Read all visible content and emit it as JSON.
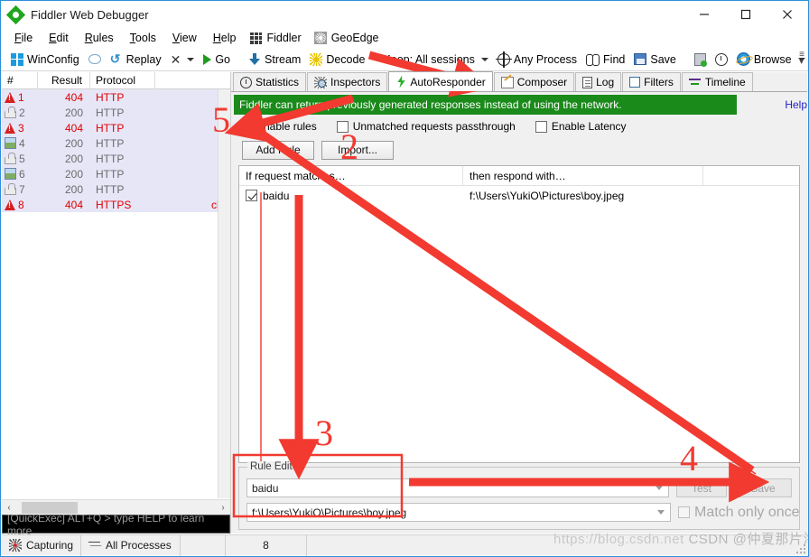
{
  "window": {
    "title": "Fiddler Web Debugger",
    "logo_icon": "fiddler-diamond-icon",
    "minimize_label": "—",
    "maximize_label": "□",
    "close_label": "✕"
  },
  "menubar": {
    "items": [
      {
        "label": "File",
        "mnemonic": "F"
      },
      {
        "label": "Edit",
        "mnemonic": "E"
      },
      {
        "label": "Rules",
        "mnemonic": "R"
      },
      {
        "label": "Tools",
        "mnemonic": "T"
      },
      {
        "label": "View",
        "mnemonic": "V"
      },
      {
        "label": "Help",
        "mnemonic": "H"
      }
    ],
    "plugins": [
      {
        "label": "Fiddler",
        "icon": "fiddler-grid-icon"
      },
      {
        "label": "GeoEdge",
        "icon": "geoedge-globe-icon"
      }
    ]
  },
  "toolbar": {
    "winconfig": "WinConfig",
    "comment_icon": "comment-bubble-icon",
    "replay": "Replay",
    "remove": "✕",
    "go": "Go",
    "stream": "Stream",
    "decode": "Decode",
    "keep": "Keep: All sessions",
    "process": "Any Process",
    "find": "Find",
    "save": "Save",
    "screenshot_icon": "camera-clipboard-icon",
    "timer_icon": "clock-icon",
    "browse": "Browse",
    "overflow_icon": "toolbar-overflow-icon"
  },
  "sessions": {
    "columns": [
      "#",
      "Result",
      "Protocol",
      ""
    ],
    "rows": [
      {
        "icon": "warning-icon",
        "num": "1",
        "result": "404",
        "protocol": "HTTP",
        "host": "",
        "state": "error"
      },
      {
        "icon": "lock-icon",
        "num": "2",
        "result": "200",
        "protocol": "HTTP",
        "host": "",
        "state": "ok"
      },
      {
        "icon": "warning-icon",
        "num": "3",
        "result": "404",
        "protocol": "HTTP",
        "host": "",
        "state": "error"
      },
      {
        "icon": "image-icon",
        "num": "4",
        "result": "200",
        "protocol": "HTTP",
        "host": "",
        "state": "ok"
      },
      {
        "icon": "lock-icon",
        "num": "5",
        "result": "200",
        "protocol": "HTTP",
        "host": "",
        "state": "ok"
      },
      {
        "icon": "image-icon",
        "num": "6",
        "result": "200",
        "protocol": "HTTP",
        "host": "",
        "state": "ok"
      },
      {
        "icon": "lock-icon",
        "num": "7",
        "result": "200",
        "protocol": "HTTP",
        "host": "",
        "state": "ok"
      },
      {
        "icon": "warning-icon",
        "num": "8",
        "result": "404",
        "protocol": "HTTPS",
        "host": "clie",
        "state": "error"
      }
    ],
    "scroll_left_label": "‹",
    "scroll_right_label": "›"
  },
  "quickexec": {
    "text": "[QuickExec] ALT+Q > type HELP to learn more"
  },
  "tabs": [
    {
      "label": "Statistics",
      "icon": "clock-statistics-icon",
      "active": false
    },
    {
      "label": "Inspectors",
      "icon": "magnifier-icon",
      "active": false
    },
    {
      "label": "AutoResponder",
      "icon": "lightning-bolt-icon",
      "active": true
    },
    {
      "label": "Composer",
      "icon": "pencil-note-icon",
      "active": false
    },
    {
      "label": "Log",
      "icon": "log-document-icon",
      "active": false
    },
    {
      "label": "Filters",
      "icon": "filter-square-icon",
      "active": false
    },
    {
      "label": "Timeline",
      "icon": "timeline-bars-icon",
      "active": false
    }
  ],
  "autoresponder": {
    "banner": "Fiddler can return previously generated responses instead of using the network.",
    "banner_color": "#1a8a1a",
    "help_link": "Help",
    "help_color": "#2222cc",
    "options": [
      {
        "label": "Enable rules",
        "checked": true
      },
      {
        "label": "Unmatched requests passthrough",
        "checked": false
      },
      {
        "label": "Enable Latency",
        "checked": false
      }
    ],
    "buttons": [
      {
        "label": "Add Rule"
      },
      {
        "label": "Import..."
      }
    ],
    "list": {
      "headers": [
        "If request matches…",
        "then respond with…",
        ""
      ],
      "rows": [
        {
          "checked": true,
          "match": "baidu",
          "respond": "f:\\Users\\YukiO\\Pictures\\boy.jpeg"
        }
      ]
    },
    "rule_editor": {
      "legend": "Rule Editor",
      "match_value": "baidu",
      "respond_value": "f:\\Users\\YukiO\\Pictures\\boy.jpeg",
      "test_label": "Test",
      "save_label": "Save",
      "match_once_label": "Match only once",
      "match_once_checked": false
    }
  },
  "statusbar": {
    "capturing": "Capturing",
    "capturing_icon": "capture-bolt-icon",
    "processes": "All Processes",
    "processes_icon": "funnel-icon",
    "count": "8"
  },
  "watermark": {
    "url": "https://blog.csdn.net",
    "brand": "CSDN @仲夏那片海"
  },
  "annotations": {
    "accent_color": "#f23a30",
    "markers": [
      {
        "label": "5"
      },
      {
        "label": "2"
      },
      {
        "label": "3"
      },
      {
        "label": "4"
      }
    ]
  }
}
